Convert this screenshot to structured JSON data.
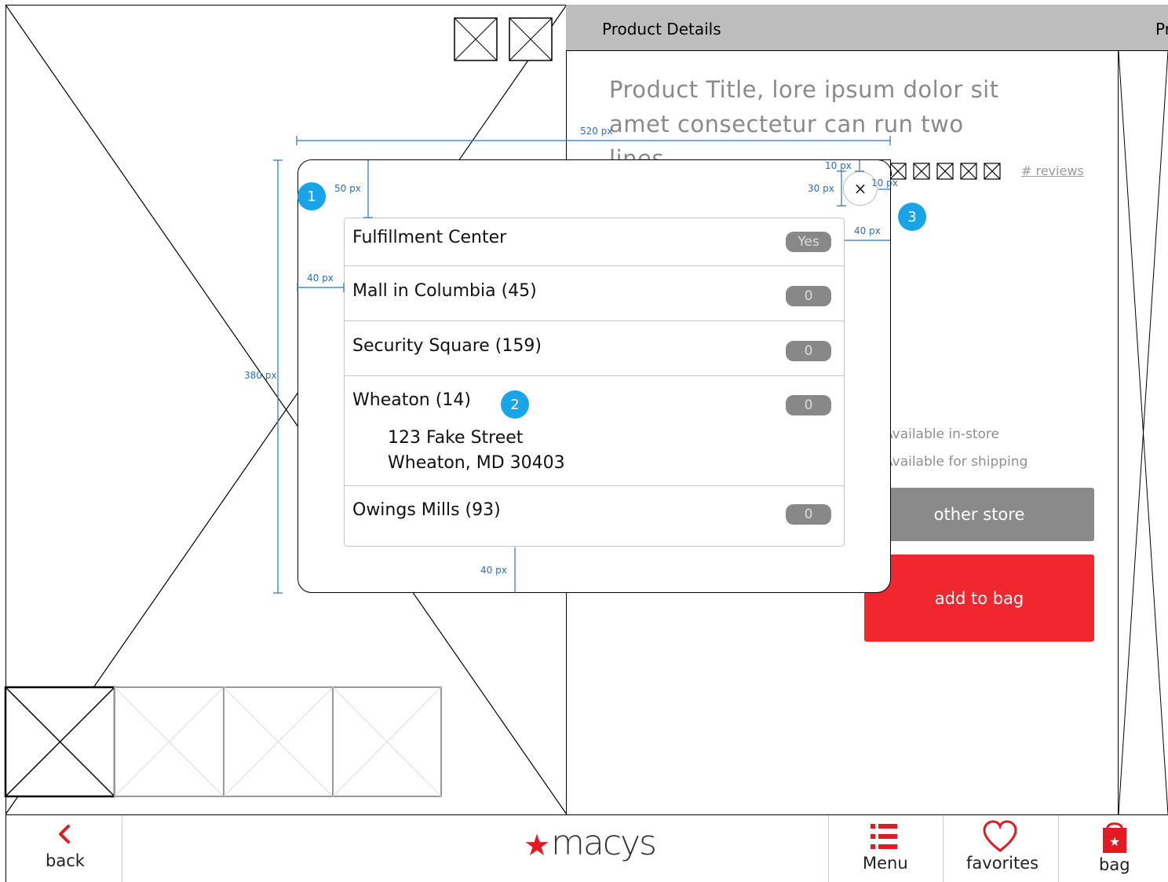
{
  "panel": {
    "header": "Product Details",
    "next_header": "Pr",
    "product_title": "Product Title, lore ipsum dolor sit amet consectetur can run two lines…",
    "reviews": "# reviews",
    "available_instore": "Available in-store",
    "available_shipping": "Available for shipping",
    "other_store_button": "other store",
    "add_to_bag_button": "add to bag"
  },
  "modal": {
    "close": "×",
    "stores": [
      {
        "label": "Fulfillment Center",
        "value": "Yes"
      },
      {
        "label": "Mall in Columbia (45)",
        "value": "0"
      },
      {
        "label": "Security Square (159)",
        "value": "0"
      },
      {
        "label": "Wheaton (14)",
        "value": "0",
        "address_line1": "123 Fake Street",
        "address_line2": "Wheaton, MD  30403"
      },
      {
        "label": "Owings Mills (93)",
        "value": "0"
      }
    ]
  },
  "annotations": {
    "badges": [
      "1",
      "2",
      "3"
    ],
    "dimensions": {
      "width": "520 px",
      "height": "380 px",
      "top_padding": "50 px",
      "left_padding": "40 px",
      "right_padding": "40 px",
      "bottom_padding": "40 px",
      "close_top": "10 px",
      "close_size": "30 px",
      "close_right": "10 px"
    }
  },
  "nav": {
    "back": "back",
    "logo": "macys",
    "menu": "Menu",
    "favorites": "favorites",
    "bag": "bag"
  },
  "colors": {
    "accent_red": "#f2262f",
    "annotation_blue": "#1aa4e8",
    "gray_button": "#8a8a8a"
  }
}
